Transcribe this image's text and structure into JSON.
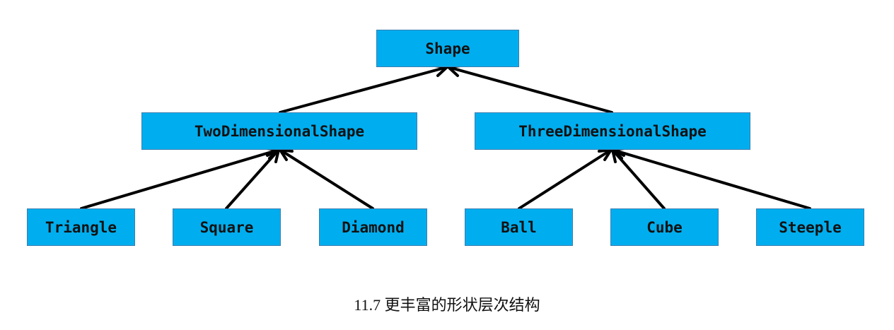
{
  "diagram": {
    "nodes": {
      "shape": "Shape",
      "two_dimensional": "TwoDimensionalShape",
      "three_dimensional": "ThreeDimensionalShape",
      "triangle": "Triangle",
      "square": "Square",
      "diamond": "Diamond",
      "ball": "Ball",
      "cube": "Cube",
      "steeple": "Steeple"
    },
    "edges": [
      [
        "two_dimensional",
        "shape"
      ],
      [
        "three_dimensional",
        "shape"
      ],
      [
        "triangle",
        "two_dimensional"
      ],
      [
        "square",
        "two_dimensional"
      ],
      [
        "diamond",
        "two_dimensional"
      ],
      [
        "ball",
        "three_dimensional"
      ],
      [
        "cube",
        "three_dimensional"
      ],
      [
        "steeple",
        "three_dimensional"
      ]
    ],
    "node_color": "#00aeef",
    "edge_color": "#000000"
  },
  "caption": "11.7 更丰富的形状层次结构"
}
